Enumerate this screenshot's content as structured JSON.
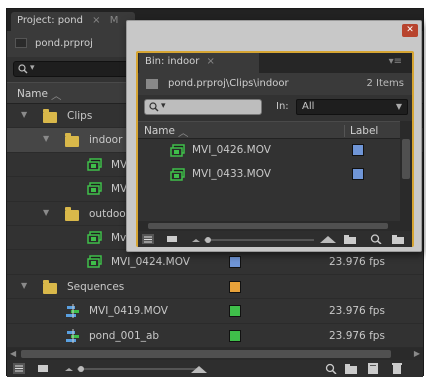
{
  "project_panel": {
    "tab_label": "Project: pond",
    "menu_glyph": "M",
    "file_name": "pond.prproj",
    "search_dropdown": "▾",
    "column_name": "Name",
    "rows": [
      {
        "name": "Clips",
        "type": "folder",
        "expanded": true,
        "indent": 0
      },
      {
        "name": "indoor",
        "type": "folder",
        "expanded": true,
        "indent": 1,
        "selected": true
      },
      {
        "name": "MVI",
        "type": "clip",
        "indent": 2
      },
      {
        "name": "MV",
        "type": "clip",
        "indent": 2
      },
      {
        "name": "outdoo",
        "type": "folder",
        "expanded": true,
        "indent": 1
      },
      {
        "name": "Mv",
        "type": "clip",
        "indent": 2
      },
      {
        "name": "MVI_0424.MOV",
        "type": "clip",
        "indent": 2,
        "label_color": "#6f95d6",
        "fps": "23.976 fps"
      },
      {
        "name": "Sequences",
        "type": "folder",
        "expanded": true,
        "indent": 0,
        "label_color": "#e8a23a"
      },
      {
        "name": "MVI_0419.MOV",
        "type": "sequence",
        "indent": 1,
        "label_color": "#3fbf4a",
        "fps": "23.976 fps"
      },
      {
        "name": "pond_001_ab",
        "type": "sequence",
        "indent": 1,
        "label_color": "#3fbf4a",
        "fps": "23.976 fps"
      }
    ]
  },
  "bin_window": {
    "tab_label": "Bin: indoor",
    "menu_glyph": "▾≡",
    "close_glyph": "✕",
    "path": "pond.prproj\\Clips\\indoor",
    "item_count": "2 Items",
    "search_dropdown": "▾",
    "in_label": "In:",
    "in_value": "All",
    "column_name": "Name",
    "column_label": "Label",
    "items": [
      {
        "name": "MVI_0426.MOV",
        "label_color": "#6f95d6"
      },
      {
        "name": "MVI_0433.MOV",
        "label_color": "#6f95d6"
      }
    ]
  },
  "colors": {
    "panel_bg": "#323232",
    "highlight_border": "#d6a533",
    "folder": "#d9b84a",
    "clip_icon": "#3fbf4a",
    "sequence_icon": "#5aa0e0"
  },
  "icons": [
    "search-icon",
    "folder-icon",
    "clip-icon",
    "sequence-icon",
    "list-view-icon",
    "icon-view-icon",
    "zoom-slider-icon",
    "new-bin-icon",
    "new-item-icon",
    "trash-icon",
    "close-icon"
  ]
}
